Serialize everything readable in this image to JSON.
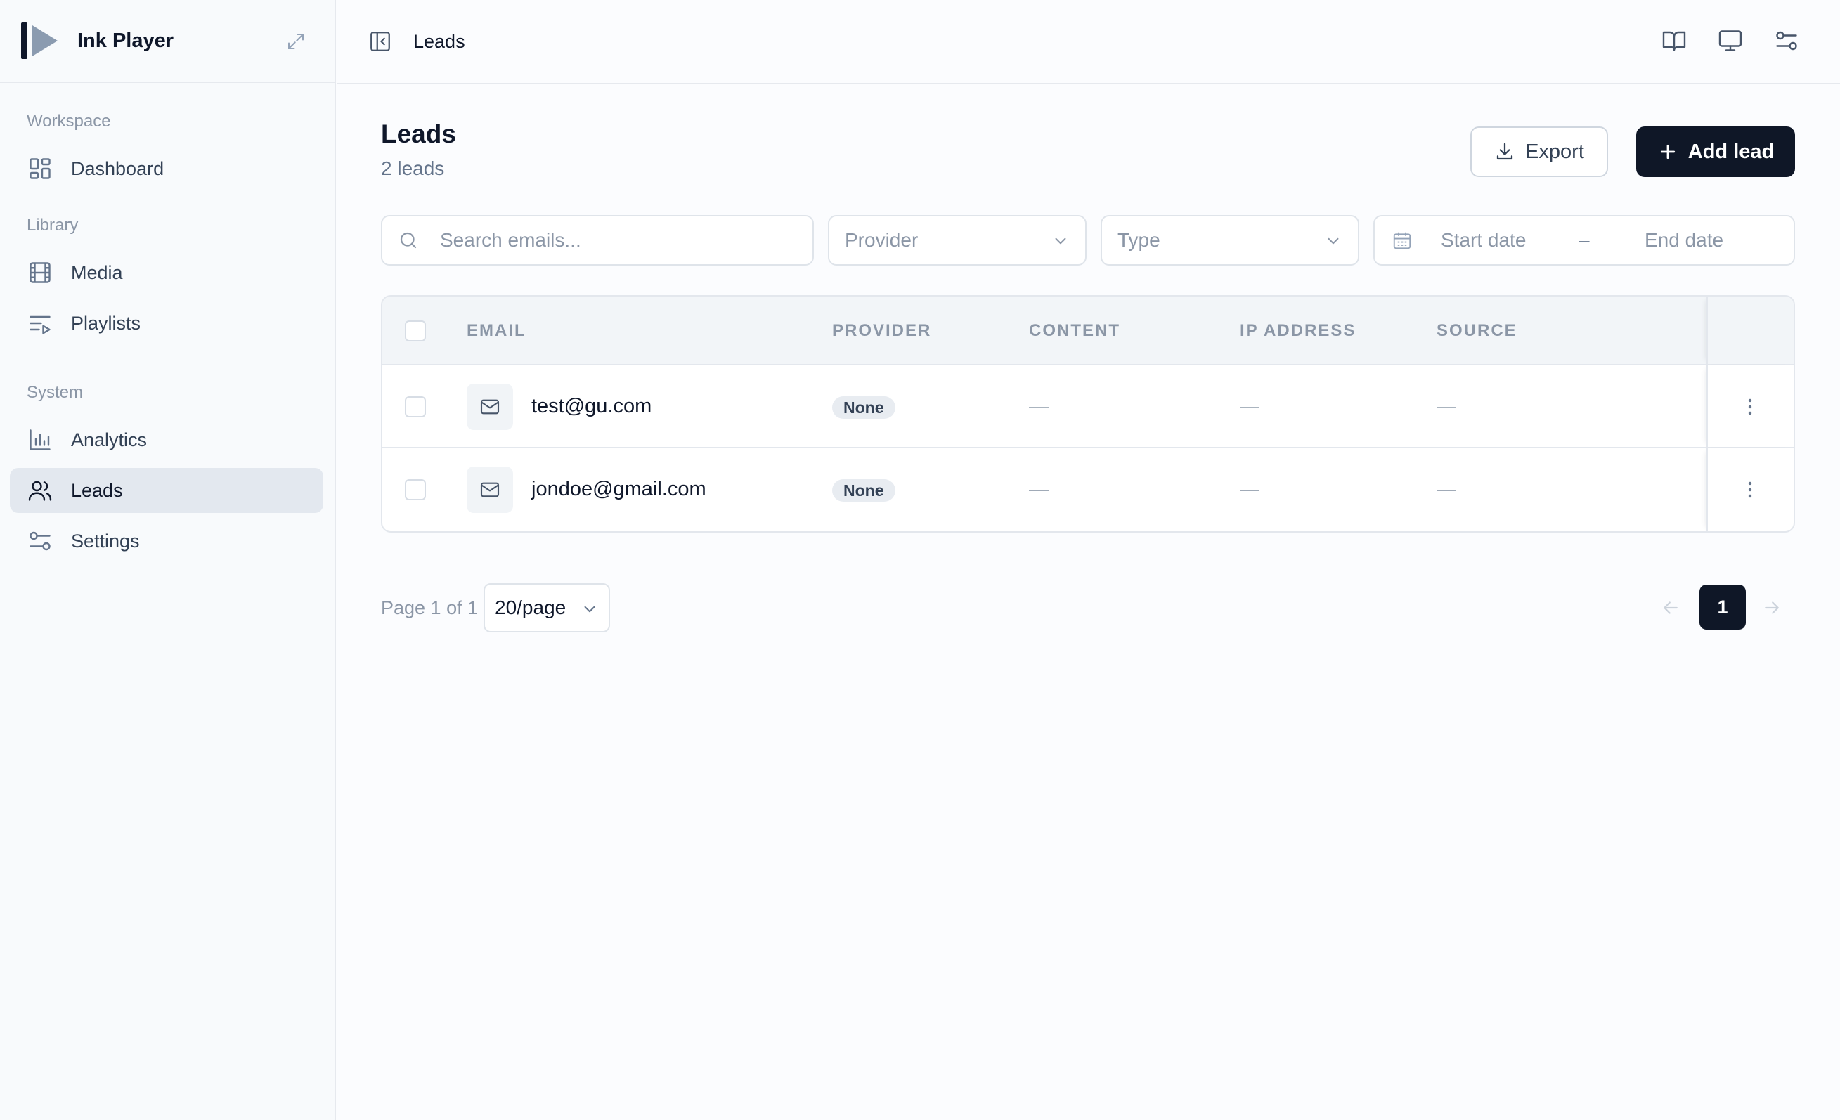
{
  "app": {
    "name": "Ink Player"
  },
  "sidebar": {
    "sections": [
      {
        "heading": "Workspace",
        "items": [
          {
            "label": "Dashboard",
            "icon": "dashboard-icon"
          }
        ]
      },
      {
        "heading": "Library",
        "items": [
          {
            "label": "Media",
            "icon": "film-icon"
          },
          {
            "label": "Playlists",
            "icon": "playlist-icon"
          }
        ]
      },
      {
        "heading": "System",
        "items": [
          {
            "label": "Analytics",
            "icon": "bar-chart-icon"
          },
          {
            "label": "Leads",
            "icon": "users-icon",
            "active": true
          },
          {
            "label": "Settings",
            "icon": "sliders-icon"
          }
        ]
      }
    ]
  },
  "topbar": {
    "breadcrumb": "Leads",
    "icons": [
      "book-icon",
      "monitor-icon",
      "sliders-icon"
    ]
  },
  "page": {
    "title": "Leads",
    "subtitle": "2 leads",
    "export_label": "Export",
    "add_label": "Add lead"
  },
  "filters": {
    "search_placeholder": "Search emails...",
    "provider_placeholder": "Provider",
    "type_placeholder": "Type",
    "start_date_placeholder": "Start date",
    "date_separator": "–",
    "end_date_placeholder": "End date"
  },
  "table": {
    "columns": [
      "EMAIL",
      "PROVIDER",
      "CONTENT",
      "IP ADDRESS",
      "SOURCE"
    ],
    "rows": [
      {
        "email": "test@gu.com",
        "provider": "None",
        "content": "—",
        "ip": "—",
        "source": "—"
      },
      {
        "email": "jondoe@gmail.com",
        "provider": "None",
        "content": "—",
        "ip": "—",
        "source": "—"
      }
    ]
  },
  "pagination": {
    "info": "Page 1 of 1",
    "per_page": "20/page",
    "current_page": "1"
  },
  "colors": {
    "primary": "#0f1727",
    "active_nav": "#e3e8ef",
    "muted_text": "#8b96a6"
  }
}
